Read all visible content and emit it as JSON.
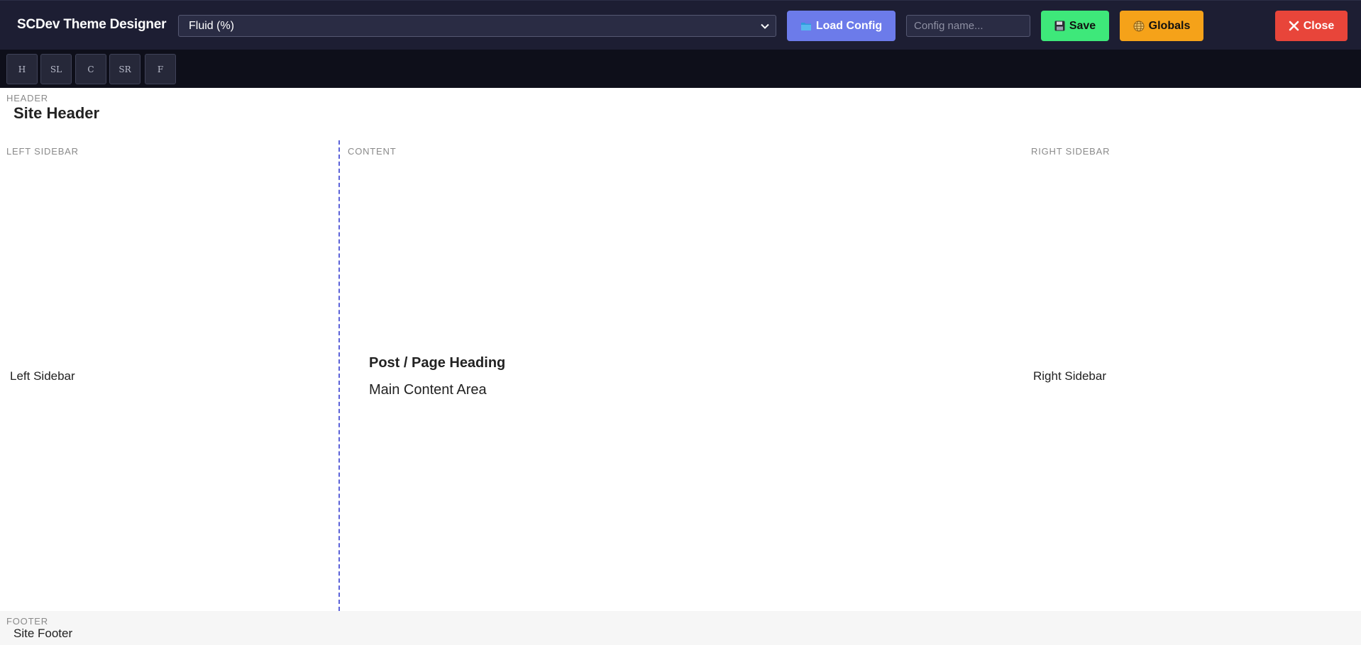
{
  "app": {
    "title": "SCDev Theme Designer"
  },
  "toolbar": {
    "layout_select": {
      "value": "Fluid (%)"
    },
    "load_label": "Load Config",
    "config_input": {
      "placeholder": "Config name...",
      "value": ""
    },
    "save_label": "Save",
    "globals_label": "Globals",
    "close_label": "Close",
    "icons": {
      "load": "folder-icon",
      "save": "floppy-disk-icon",
      "globals": "globe-icon",
      "close": "x-icon"
    }
  },
  "zones": [
    {
      "label": "H"
    },
    {
      "label": "SL"
    },
    {
      "label": "C"
    },
    {
      "label": "SR"
    },
    {
      "label": "F"
    }
  ],
  "canvas": {
    "header": {
      "zone_label": "HEADER",
      "text": "Site Header"
    },
    "left_sidebar": {
      "zone_label": "LEFT SIDEBAR",
      "text": "Left Sidebar"
    },
    "content": {
      "zone_label": "CONTENT",
      "heading": "Post / Page Heading",
      "text": "Main Content Area"
    },
    "right_sidebar": {
      "zone_label": "RIGHT SIDEBAR",
      "text": "Right Sidebar"
    },
    "footer": {
      "zone_label": "FOOTER",
      "text": "Site Footer"
    }
  },
  "colors": {
    "toolbar_bg": "#1d1e33",
    "zonebar_bg": "#0e0f1a",
    "load": "#6c7bea",
    "save": "#3ee87a",
    "globals": "#f5a219",
    "close": "#e8453a",
    "divider": "#5b62d9"
  }
}
